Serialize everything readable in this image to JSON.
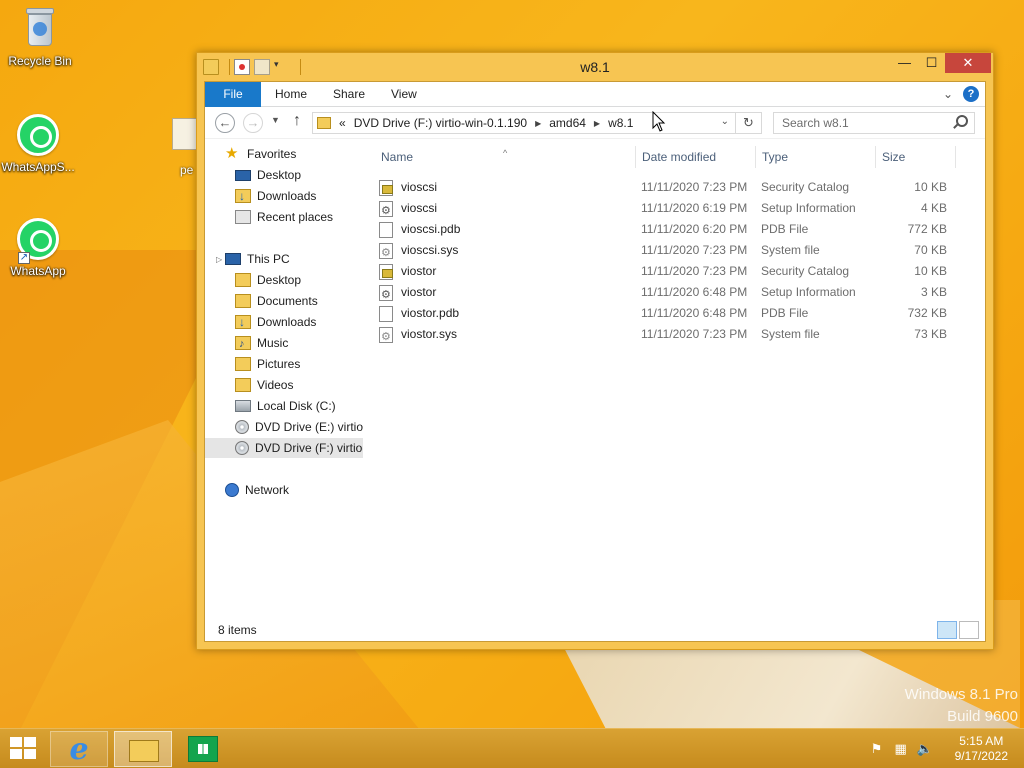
{
  "desktop": {
    "icons": [
      {
        "label": "Recycle Bin"
      },
      {
        "label": "WhatsAppS..."
      },
      {
        "label": "WhatsApp"
      }
    ],
    "partial_icon_label": "pe",
    "watermark": {
      "line1": "Windows 8.1 Pro",
      "line2": "Build 9600"
    }
  },
  "window": {
    "title": "w8.1",
    "controls": {
      "minimize": "—",
      "maximize": "☐",
      "close": "✕"
    },
    "ribbon": {
      "tabs": [
        {
          "label": "File",
          "active": true
        },
        {
          "label": "Home"
        },
        {
          "label": "Share"
        },
        {
          "label": "View"
        }
      ],
      "help": "?"
    },
    "address": {
      "prefix": "«",
      "segments": [
        "DVD Drive (F:) virtio-win-0.1.190",
        "amd64",
        "w8.1"
      ]
    },
    "search": {
      "placeholder": "Search w8.1"
    },
    "nav_pane": {
      "favorites": {
        "label": "Favorites",
        "items": [
          "Desktop",
          "Downloads",
          "Recent places"
        ]
      },
      "this_pc": {
        "label": "This PC",
        "items": [
          "Desktop",
          "Documents",
          "Downloads",
          "Music",
          "Pictures",
          "Videos",
          "Local Disk (C:)",
          "DVD Drive (E:) virtio-",
          "DVD Drive (F:) virtio-"
        ]
      },
      "network": {
        "label": "Network"
      },
      "selected": "DVD Drive (F:) virtio-"
    },
    "columns": [
      "Name",
      "Date modified",
      "Type",
      "Size"
    ],
    "files": [
      {
        "name": "vioscsi",
        "date": "11/11/2020 7:23 PM",
        "type": "Security Catalog",
        "size": "10 KB",
        "icon": "catalog-icon"
      },
      {
        "name": "vioscsi",
        "date": "11/11/2020 6:19 PM",
        "type": "Setup Information",
        "size": "4 KB",
        "icon": "setup-info-icon"
      },
      {
        "name": "vioscsi.pdb",
        "date": "11/11/2020 6:20 PM",
        "type": "PDB File",
        "size": "772 KB",
        "icon": "file-icon"
      },
      {
        "name": "vioscsi.sys",
        "date": "11/11/2020 7:23 PM",
        "type": "System file",
        "size": "70 KB",
        "icon": "system-file-icon"
      },
      {
        "name": "viostor",
        "date": "11/11/2020 7:23 PM",
        "type": "Security Catalog",
        "size": "10 KB",
        "icon": "catalog-icon"
      },
      {
        "name": "viostor",
        "date": "11/11/2020 6:48 PM",
        "type": "Setup Information",
        "size": "3 KB",
        "icon": "setup-info-icon"
      },
      {
        "name": "viostor.pdb",
        "date": "11/11/2020 6:48 PM",
        "type": "PDB File",
        "size": "732 KB",
        "icon": "file-icon"
      },
      {
        "name": "viostor.sys",
        "date": "11/11/2020 7:23 PM",
        "type": "System file",
        "size": "73 KB",
        "icon": "system-file-icon"
      }
    ],
    "status": "8 items"
  },
  "taskbar": {
    "clock": {
      "time": "5:15 AM",
      "date": "9/17/2022"
    }
  },
  "colors": {
    "accent": "#1979ca",
    "desktop": "#f5a80f",
    "window_frame": "#f7c552",
    "close": "#c7463c"
  }
}
